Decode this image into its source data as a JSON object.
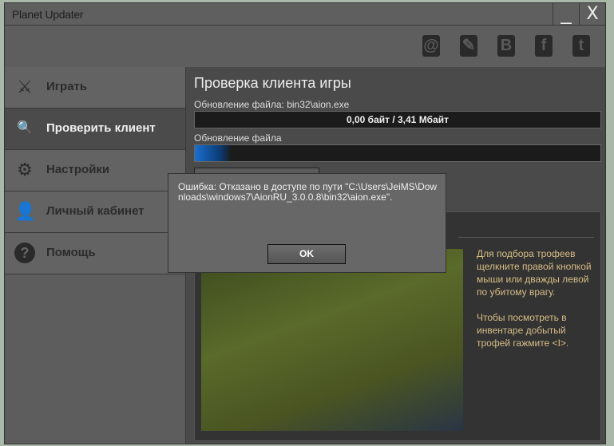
{
  "window": {
    "title": "Planet Updater",
    "minimize": "_",
    "close": "X"
  },
  "social": [
    {
      "icon": "circle-logo-icon",
      "glyph": "@"
    },
    {
      "icon": "pencil-icon",
      "glyph": "✎"
    },
    {
      "icon": "b-icon",
      "glyph": "B"
    },
    {
      "icon": "facebook-icon",
      "glyph": "f"
    },
    {
      "icon": "twitter-icon",
      "glyph": "t"
    }
  ],
  "sidebar": {
    "items": [
      {
        "label": "Играть",
        "icon": "swords-icon",
        "glyph": "⚔"
      },
      {
        "label": "Проверить клиент",
        "icon": "monitor-search-icon",
        "glyph": "🔍"
      },
      {
        "label": "Настройки",
        "icon": "gears-icon",
        "glyph": "⚙"
      },
      {
        "label": "Личный кабинет",
        "icon": "user-icon",
        "glyph": "👤"
      },
      {
        "label": "Помощь",
        "icon": "help-icon",
        "glyph": "?"
      }
    ]
  },
  "main": {
    "title": "Проверка клиента игры",
    "file_label": "Обновление файла: bin32\\aion.exe",
    "file_progress": "0,00 байт / 3,41 Мбайт",
    "total_label": "Обновление файла",
    "total_progress_percent": 3
  },
  "news": {
    "para1": "Для подбора трофеев щелкните правой кнопкой мыши или дважды левой по убитому врагу.",
    "para2": "Чтобы посмотреть в инвентаре добытый трофей гажмите <I>."
  },
  "dialog": {
    "message": "Ошибка: Отказано в доступе по пути \"C:\\Users\\JeiMS\\Downloads\\windows7\\AionRU_3.0.0.8\\bin32\\aion.exe\".",
    "ok": "OK"
  }
}
